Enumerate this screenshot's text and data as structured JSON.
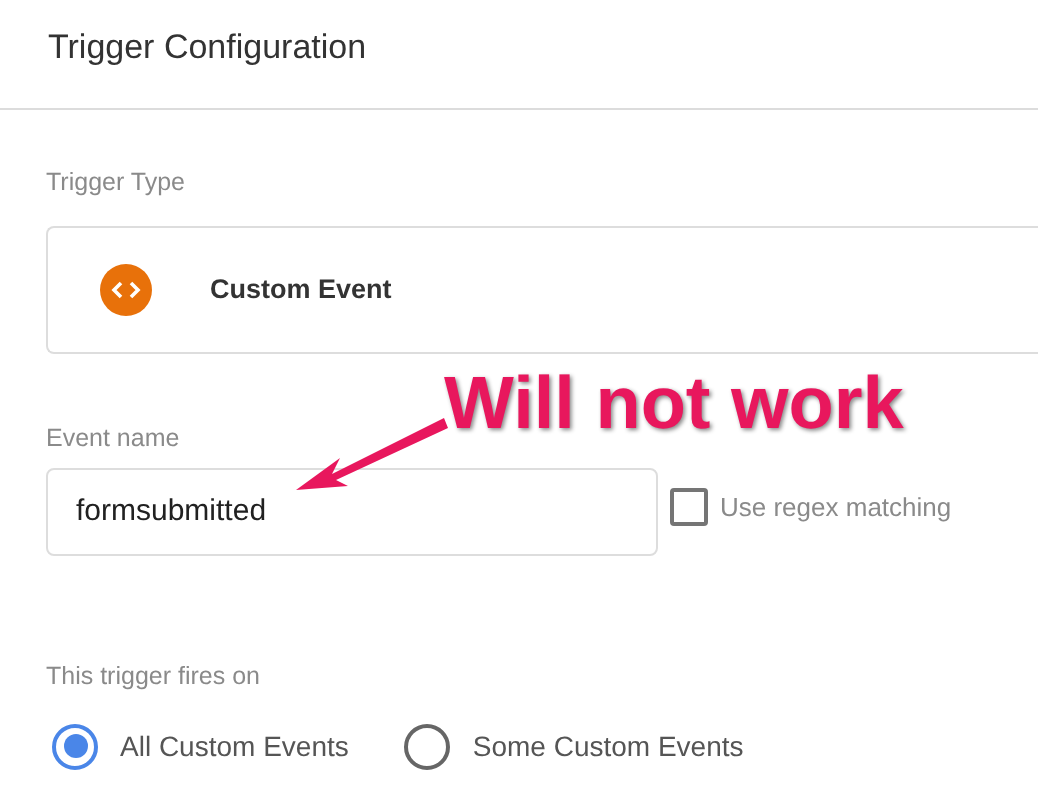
{
  "title": "Trigger Configuration",
  "trigger_type": {
    "label": "Trigger Type",
    "name": "Custom Event"
  },
  "event_name": {
    "label": "Event name",
    "value": "formsubmitted"
  },
  "regex": {
    "label": "Use regex matching",
    "checked": false
  },
  "fires_on": {
    "label": "This trigger fires on",
    "options": [
      {
        "label": "All Custom Events",
        "selected": true
      },
      {
        "label": "Some Custom Events",
        "selected": false
      }
    ]
  },
  "annotation": {
    "text": "Will not work"
  }
}
